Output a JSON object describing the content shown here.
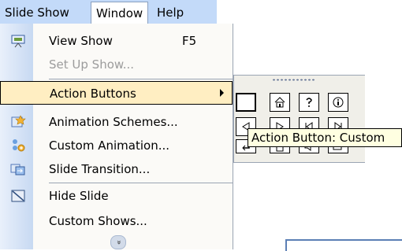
{
  "menubar": {
    "items": [
      {
        "label": "Slide Show"
      },
      {
        "label": "Window"
      },
      {
        "label": "Help"
      }
    ]
  },
  "menu": {
    "items": [
      {
        "label": "View Show",
        "shortcut": "F5",
        "icon": "view-show-icon"
      },
      {
        "label": "Set Up Show...",
        "disabled": true
      },
      {
        "label": "Action Buttons",
        "has_submenu": true
      },
      {
        "label": "Animation Schemes...",
        "icon": "animation-schemes-icon"
      },
      {
        "label": "Custom Animation...",
        "icon": "custom-animation-icon"
      },
      {
        "label": "Slide Transition...",
        "icon": "slide-transition-icon"
      },
      {
        "label": "Hide Slide",
        "icon": "hide-slide-icon"
      },
      {
        "label": "Custom Shows..."
      }
    ],
    "expand_glyph": "»"
  },
  "submenu": {
    "buttons_row1": [
      "custom",
      "home",
      "help",
      "information"
    ],
    "buttons_row2": [
      "back",
      "forward",
      "beginning",
      "end"
    ],
    "buttons_row3": [
      "return",
      "document",
      "sound",
      "movie"
    ]
  },
  "tooltip": {
    "text": "Action Button: Custom"
  },
  "colors": {
    "highlight": "#ffeec2",
    "menubar": "#c3daf9",
    "tooltip_bg": "#ffffe1"
  }
}
